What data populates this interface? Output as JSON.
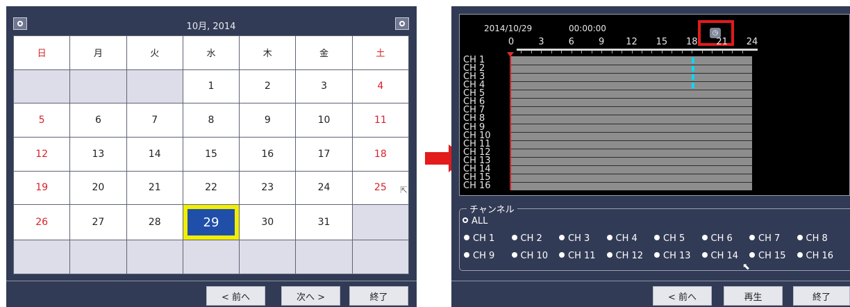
{
  "calendar": {
    "title": "10月, 2014",
    "weekdays": [
      "日",
      "月",
      "火",
      "水",
      "木",
      "金",
      "土"
    ],
    "rows": [
      [
        "",
        "",
        "",
        "1",
        "2",
        "3",
        "4"
      ],
      [
        "5",
        "6",
        "7",
        "8",
        "9",
        "10",
        "11"
      ],
      [
        "12",
        "13",
        "14",
        "15",
        "16",
        "17",
        "18"
      ],
      [
        "19",
        "20",
        "21",
        "22",
        "23",
        "24",
        "25"
      ],
      [
        "26",
        "27",
        "28",
        "29",
        "30",
        "31",
        ""
      ],
      [
        "",
        "",
        "",
        "",
        "",
        "",
        ""
      ]
    ],
    "selected_day": "29",
    "prev_label": "< 前へ",
    "next_label": "次へ >",
    "close_label": "終了"
  },
  "timeline": {
    "date": "2014/10/29",
    "time": "00:00:00",
    "clock_icon": "clock-icon",
    "hour_ticks": [
      "0",
      "3",
      "6",
      "9",
      "12",
      "15",
      "18",
      "21",
      "24"
    ],
    "channels": [
      "CH 1",
      "CH 2",
      "CH 3",
      "CH 4",
      "CH 5",
      "CH 6",
      "CH 7",
      "CH 8",
      "CH 9",
      "CH 10",
      "CH 11",
      "CH 12",
      "CH 13",
      "CH 14",
      "CH 15",
      "CH 16"
    ],
    "recorded_hour": 18,
    "recorded_channels": [
      1,
      2,
      3,
      4
    ]
  },
  "channel_select": {
    "title": "チャンネル",
    "all_label": "ALL",
    "row1": [
      "CH 1",
      "CH 2",
      "CH 3",
      "CH 4",
      "CH 5",
      "CH 6",
      "CH 7",
      "CH 8"
    ],
    "row2": [
      "CH 9",
      "CH 10",
      "CH 11",
      "CH 12",
      "CH 13",
      "CH 14",
      "CH 15",
      "CH 16"
    ]
  },
  "footer": {
    "prev_label": "< 前へ",
    "play_label": "再生",
    "close_label": "終了"
  },
  "colors": {
    "panel": "#323b55",
    "selected_day": "#1f4fa8",
    "selected_border": "#f2ee00",
    "holiday_text": "#d8202a",
    "record_mark": "#00d8f4",
    "highlight": "#e11a1a"
  }
}
